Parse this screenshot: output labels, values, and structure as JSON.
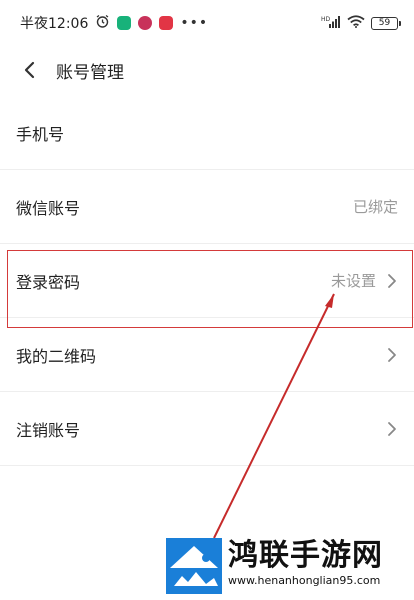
{
  "status_bar": {
    "time": "半夜12:06",
    "network": "HD",
    "battery": "59"
  },
  "nav": {
    "title": "账号管理"
  },
  "rows": [
    {
      "label": "手机号",
      "value": ""
    },
    {
      "label": "微信账号",
      "value": "已绑定"
    },
    {
      "label": "登录密码",
      "value": "未设置"
    },
    {
      "label": "我的二维码",
      "value": ""
    },
    {
      "label": "注销账号",
      "value": ""
    }
  ],
  "watermark": {
    "title": "鸿联手游网",
    "url": "www.henanhonglian95.com"
  },
  "colors": {
    "highlight": "#d43a3a",
    "value_text": "#9a9a9a",
    "logo_blue": "#1a7fd8"
  },
  "icons": [
    "back-arrow-icon",
    "chevron-right-icon",
    "alarm-icon",
    "wifi-icon",
    "signal-icon",
    "battery-icon"
  ]
}
